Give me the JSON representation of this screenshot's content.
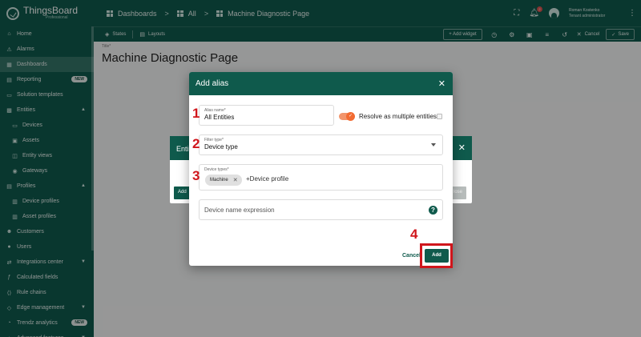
{
  "app": {
    "brand": "ThingsBoard",
    "brand_sub": "Professional"
  },
  "sidebar": {
    "items": [
      {
        "label": "Home",
        "icon": "home-icon"
      },
      {
        "label": "Alarms",
        "icon": "alarm-icon"
      },
      {
        "label": "Dashboards",
        "icon": "dashboard-icon",
        "active": true
      },
      {
        "label": "Reporting",
        "icon": "reporting-icon",
        "badge": "NEW"
      },
      {
        "label": "Solution templates",
        "icon": "template-icon"
      },
      {
        "label": "Entities",
        "icon": "entities-icon",
        "expanded": true
      },
      {
        "label": "Devices",
        "icon": "device-icon",
        "sub": true
      },
      {
        "label": "Assets",
        "icon": "asset-icon",
        "sub": true
      },
      {
        "label": "Entity views",
        "icon": "entity-view-icon",
        "sub": true
      },
      {
        "label": "Gateways",
        "icon": "gateway-icon",
        "sub": true
      },
      {
        "label": "Profiles",
        "icon": "profiles-icon",
        "expanded": true
      },
      {
        "label": "Device profiles",
        "icon": "device-profile-icon",
        "sub": true
      },
      {
        "label": "Asset profiles",
        "icon": "asset-profile-icon",
        "sub": true
      },
      {
        "label": "Customers",
        "icon": "customers-icon"
      },
      {
        "label": "Users",
        "icon": "users-icon"
      },
      {
        "label": "Integrations center",
        "icon": "integrations-icon",
        "collapsed": true
      },
      {
        "label": "Calculated fields",
        "icon": "calculated-icon"
      },
      {
        "label": "Rule chains",
        "icon": "rule-chain-icon"
      },
      {
        "label": "Edge management",
        "icon": "edge-icon",
        "collapsed": true
      },
      {
        "label": "Trendz analytics",
        "icon": "trendz-icon",
        "badge": "NEW"
      },
      {
        "label": "Advanced features",
        "icon": "advanced-icon",
        "collapsed": true
      }
    ]
  },
  "topbar": {
    "crumb1": "Dashboards",
    "crumb2": "All",
    "crumb3": "Machine Diagnostic Page",
    "notification_count": "2",
    "user_name": "Roman Kostenko",
    "user_role": "Tenant administrator"
  },
  "toolbar": {
    "states": "States",
    "layouts": "Layouts",
    "add_widget": "+ Add widget",
    "cancel": "Cancel",
    "save": "Save"
  },
  "main": {
    "title_label": "Title*",
    "title": "Machine Diagnostic Page"
  },
  "bg_dialog": {
    "title_fragment": "Enti",
    "add_left": "Add",
    "add_right": "lose"
  },
  "dialog": {
    "title": "Add alias",
    "alias_name_label": "Alias name*",
    "alias_name_value": "All Entities",
    "resolve_label": "Resolve as multiple entities",
    "filter_type_label": "Filter type*",
    "filter_type_value": "Device type",
    "device_types_label": "Device types*",
    "chip": "Machine",
    "chip_placeholder": "+Device profile",
    "expression_placeholder": "Device name expression",
    "cancel": "Cancel",
    "add": "Add"
  },
  "annotations": {
    "n1": "1",
    "n2": "2",
    "n3": "3",
    "n4": "4"
  },
  "colors": {
    "primary": "#0f5a4c",
    "accent": "#f26b32",
    "annotation": "#d0161c"
  }
}
